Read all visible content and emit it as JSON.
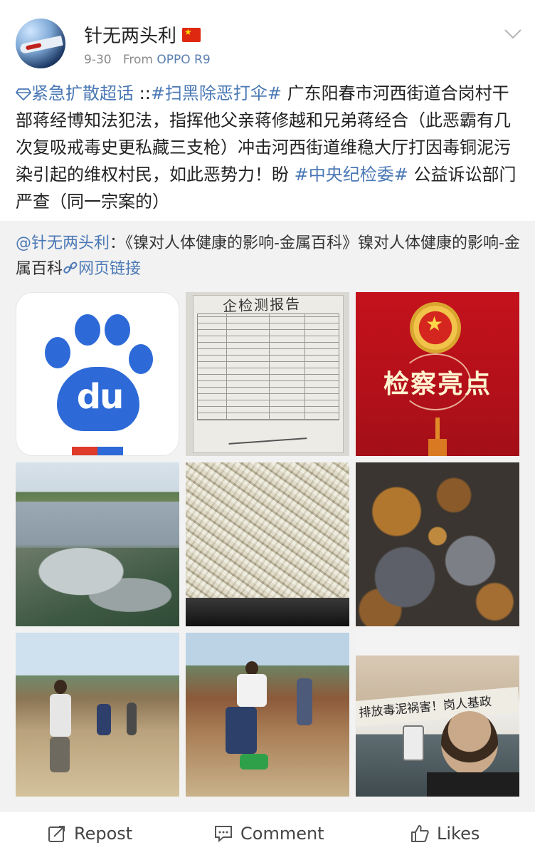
{
  "header": {
    "username": "针无两头利",
    "date": "9-30",
    "from_label": "From",
    "device": "OPPO R9"
  },
  "post": {
    "supertopic_link": "紧急扩散超话",
    "separator": "::",
    "hashtag1": "#扫黑除恶打伞#",
    "body": " 广东阳春市河西街道合岗村干部蒋经博知法犯法，指挥他父亲蒋修越和兄弟蒋经合（此恶霸有几次复吸戒毒史更私藏三支枪）冲击河西街道维稳大厅打因毒铜泥污染引起的维权村民，如此恶势力！盼 ",
    "hashtag2": "#中央纪检委#",
    "body_tail": " 公益诉讼部门严查（同一宗案的）"
  },
  "repost": {
    "mention": "@针无两头利",
    "colon": "：",
    "text": "《镍对人体健康的影响-金属百科》镍对人体健康的影响-金属百科",
    "link_label": "网页链接"
  },
  "images": {
    "tile1": {
      "icon": "baidu-paw-icon",
      "text": "du"
    },
    "tile2": {
      "handwriting": "企检测报告"
    },
    "tile3": {
      "title": "检察亮点"
    },
    "tile9": {
      "banner": "排放毒泥祸害！岗人基政"
    }
  },
  "footer": {
    "repost": "Repost",
    "comment": "Comment",
    "likes": "Likes"
  },
  "colors": {
    "link": "#4a78b5",
    "repost_bg": "#f2f2f2",
    "baidu_blue": "#2d6ad8"
  }
}
